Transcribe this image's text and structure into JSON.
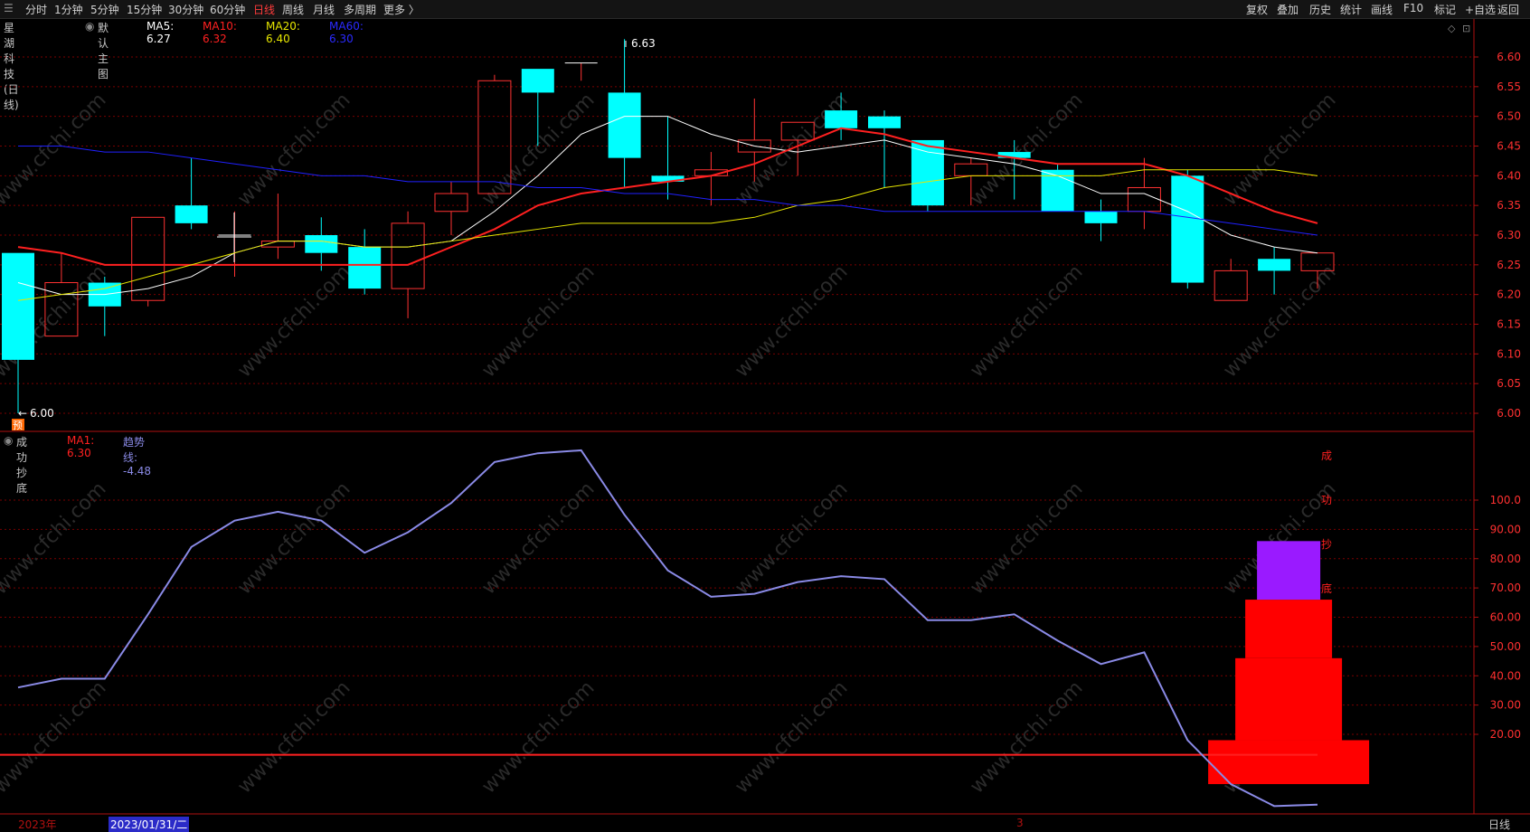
{
  "toolbar": {
    "left_items": [
      "分时",
      "1分钟",
      "5分钟",
      "15分钟",
      "30分钟",
      "60分钟",
      "日线",
      "周线",
      "月线",
      "多周期",
      "更多 〉"
    ],
    "active_index": 6,
    "right_items": [
      "复权",
      "叠加",
      "历史",
      "统计",
      "画线",
      "F10",
      "标记",
      "+自选",
      "返回"
    ]
  },
  "main": {
    "stock_title": "星湖科技(日线)",
    "template": "默认主图",
    "ma5": "MA5: 6.27",
    "ma10": "MA10: 6.32",
    "ma20": "MA20: 6.40",
    "ma60": "MA60: 6.30",
    "high_label": "6.63",
    "low_label": "6.00",
    "pre_badge": "预",
    "y_ticks": [
      "6.60",
      "6.55",
      "6.50",
      "6.45",
      "6.40",
      "6.35",
      "6.30",
      "6.25",
      "6.20",
      "6.15",
      "6.10",
      "6.05",
      "6.00"
    ]
  },
  "indicator": {
    "name": "成功抄底",
    "ma1": "MA1: 6.30",
    "trend": "趋势线: -4.48",
    "vertical_text": [
      "成",
      "功",
      "抄",
      "底"
    ],
    "y_ticks": [
      "100.0",
      "90.00",
      "80.00",
      "70.00",
      "60.00",
      "50.00",
      "40.00",
      "30.00",
      "20.00"
    ]
  },
  "footer": {
    "year": "2023年",
    "date": "2023/01/31/二",
    "marker": "3",
    "period": "日线"
  },
  "watermark": "www.cfchi.com",
  "colors": {
    "up": "#ff3232",
    "down": "#00ffff",
    "ma5": "#ffffff",
    "ma10": "#ff2020",
    "ma20": "#e6e600",
    "ma60": "#2020ff",
    "trend": "#8a8ae6",
    "bar_purple": "#9a1aff",
    "bar_red": "#ff0000"
  },
  "chart_data": [
    {
      "type": "candlestick",
      "title": "星湖科技(日线)",
      "ylim": [
        5.98,
        6.65
      ],
      "candles": [
        {
          "o": 6.27,
          "h": 6.27,
          "l": 6.0,
          "c": 6.09
        },
        {
          "o": 6.13,
          "h": 6.27,
          "l": 6.13,
          "c": 6.22
        },
        {
          "o": 6.22,
          "h": 6.23,
          "l": 6.13,
          "c": 6.18
        },
        {
          "o": 6.19,
          "h": 6.33,
          "l": 6.18,
          "c": 6.33
        },
        {
          "o": 6.35,
          "h": 6.43,
          "l": 6.31,
          "c": 6.32
        },
        {
          "o": 6.3,
          "h": 6.34,
          "l": 6.23,
          "c": 6.3
        },
        {
          "o": 6.28,
          "h": 6.37,
          "l": 6.26,
          "c": 6.29
        },
        {
          "o": 6.3,
          "h": 6.33,
          "l": 6.24,
          "c": 6.27
        },
        {
          "o": 6.28,
          "h": 6.31,
          "l": 6.2,
          "c": 6.21
        },
        {
          "o": 6.21,
          "h": 6.34,
          "l": 6.16,
          "c": 6.32
        },
        {
          "o": 6.34,
          "h": 6.39,
          "l": 6.3,
          "c": 6.37
        },
        {
          "o": 6.37,
          "h": 6.57,
          "l": 6.37,
          "c": 6.56
        },
        {
          "o": 6.58,
          "h": 6.58,
          "l": 6.45,
          "c": 6.54
        },
        {
          "o": 6.59,
          "h": 6.59,
          "l": 6.56,
          "c": 6.59
        },
        {
          "o": 6.54,
          "h": 6.63,
          "l": 6.38,
          "c": 6.43
        },
        {
          "o": 6.4,
          "h": 6.5,
          "l": 6.36,
          "c": 6.39
        },
        {
          "o": 6.4,
          "h": 6.44,
          "l": 6.35,
          "c": 6.41
        },
        {
          "o": 6.44,
          "h": 6.53,
          "l": 6.39,
          "c": 6.46
        },
        {
          "o": 6.46,
          "h": 6.49,
          "l": 6.4,
          "c": 6.49
        },
        {
          "o": 6.51,
          "h": 6.54,
          "l": 6.46,
          "c": 6.48
        },
        {
          "o": 6.5,
          "h": 6.51,
          "l": 6.38,
          "c": 6.48
        },
        {
          "o": 6.46,
          "h": 6.46,
          "l": 6.34,
          "c": 6.35
        },
        {
          "o": 6.4,
          "h": 6.43,
          "l": 6.35,
          "c": 6.42
        },
        {
          "o": 6.44,
          "h": 6.46,
          "l": 6.36,
          "c": 6.43
        },
        {
          "o": 6.41,
          "h": 6.42,
          "l": 6.34,
          "c": 6.34
        },
        {
          "o": 6.34,
          "h": 6.36,
          "l": 6.29,
          "c": 6.32
        },
        {
          "o": 6.34,
          "h": 6.43,
          "l": 6.31,
          "c": 6.38
        },
        {
          "o": 6.4,
          "h": 6.41,
          "l": 6.21,
          "c": 6.22
        },
        {
          "o": 6.19,
          "h": 6.26,
          "l": 6.19,
          "c": 6.24
        },
        {
          "o": 6.26,
          "h": 6.28,
          "l": 6.2,
          "c": 6.24
        },
        {
          "o": 6.24,
          "h": 6.27,
          "l": 6.21,
          "c": 6.27
        }
      ],
      "series": [
        {
          "name": "MA5",
          "values": [
            6.22,
            6.2,
            6.2,
            6.21,
            6.23,
            6.27,
            6.29,
            6.29,
            6.28,
            6.28,
            6.29,
            6.34,
            6.4,
            6.47,
            6.5,
            6.5,
            6.47,
            6.45,
            6.44,
            6.45,
            6.46,
            6.44,
            6.43,
            6.42,
            6.4,
            6.37,
            6.37,
            6.34,
            6.3,
            6.28,
            6.27
          ]
        },
        {
          "name": "MA10",
          "values": [
            6.28,
            6.27,
            6.25,
            6.25,
            6.25,
            6.25,
            6.25,
            6.25,
            6.25,
            6.25,
            6.28,
            6.31,
            6.35,
            6.37,
            6.38,
            6.39,
            6.4,
            6.42,
            6.45,
            6.48,
            6.47,
            6.45,
            6.44,
            6.43,
            6.42,
            6.42,
            6.42,
            6.4,
            6.37,
            6.34,
            6.32
          ]
        },
        {
          "name": "MA20",
          "values": [
            6.19,
            6.2,
            6.21,
            6.23,
            6.25,
            6.27,
            6.29,
            6.29,
            6.28,
            6.28,
            6.29,
            6.3,
            6.31,
            6.32,
            6.32,
            6.32,
            6.32,
            6.33,
            6.35,
            6.36,
            6.38,
            6.39,
            6.4,
            6.4,
            6.4,
            6.4,
            6.41,
            6.41,
            6.41,
            6.41,
            6.4
          ]
        },
        {
          "name": "MA60",
          "values": [
            6.45,
            6.45,
            6.44,
            6.44,
            6.43,
            6.42,
            6.41,
            6.4,
            6.4,
            6.39,
            6.39,
            6.39,
            6.38,
            6.38,
            6.37,
            6.37,
            6.36,
            6.36,
            6.35,
            6.35,
            6.34,
            6.34,
            6.34,
            6.34,
            6.34,
            6.34,
            6.34,
            6.33,
            6.32,
            6.31,
            6.3
          ]
        }
      ]
    },
    {
      "type": "line",
      "title": "成功抄底",
      "ylim": [
        0,
        125
      ],
      "series": [
        {
          "name": "趋势线",
          "values": [
            36,
            39,
            39,
            61,
            84,
            93,
            96,
            93,
            82,
            89,
            99,
            113,
            116,
            117,
            95,
            76,
            67,
            68,
            72,
            74,
            73,
            59,
            59,
            61,
            52,
            44,
            48,
            18,
            3,
            -4.5,
            -4
          ]
        },
        {
          "name": "MA1",
          "values": [
            13,
            13,
            13,
            13,
            13,
            13,
            13,
            13,
            13,
            13,
            13,
            13,
            13,
            13,
            13,
            13,
            13,
            13,
            13,
            13,
            13,
            13,
            13,
            13,
            13,
            13,
            13,
            13,
            13,
            13,
            13
          ]
        }
      ],
      "signal_bars": [
        {
          "label": "成功抄底",
          "bottom": 3,
          "top": 18,
          "width": "wide"
        },
        {
          "label": "成功抄底",
          "bottom": 18,
          "top": 46,
          "width": "medium"
        },
        {
          "label": "成功抄底",
          "bottom": 46,
          "top": 66,
          "width": "narrow"
        },
        {
          "label": "成功抄底",
          "bottom": 66,
          "top": 86,
          "width": "narrower"
        }
      ]
    }
  ]
}
